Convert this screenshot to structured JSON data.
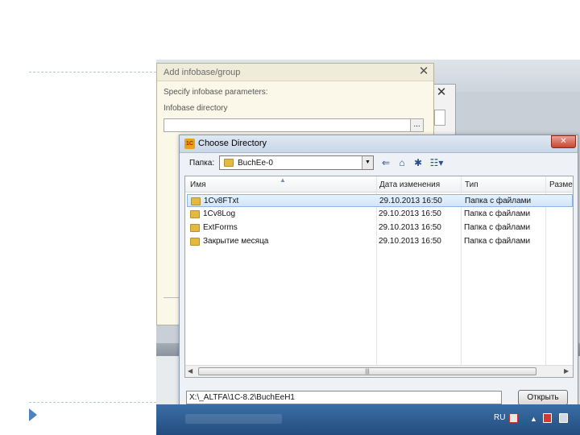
{
  "infobase_dialog": {
    "title": "Add infobase/group",
    "subtitle": "Specify infobase parameters:",
    "directory_label": "Infobase directory",
    "directory_value": "",
    "browse_label": "..."
  },
  "choose_dialog": {
    "title": "Choose Directory",
    "logo_text": "1C",
    "folder_label": "Папка:",
    "folder_value": "BuchEe-0",
    "columns": [
      "Имя",
      "Дата изменения",
      "Тип",
      "Разме"
    ],
    "rows": [
      {
        "name": "1Cv8FTxt",
        "date": "29.10.2013 16:50",
        "type": "Папка с файлами",
        "selected": true
      },
      {
        "name": "1Cv8Log",
        "date": "29.10.2013 16:50",
        "type": "Папка с файлами",
        "selected": false
      },
      {
        "name": "ExtForms",
        "date": "29.10.2013 16:50",
        "type": "Папка с файлами",
        "selected": false
      },
      {
        "name": "Закрытие месяца",
        "date": "29.10.2013 16:50",
        "type": "Папка с файлами",
        "selected": false
      }
    ],
    "path_value": "X:\\_ALTFA\\1C-8.2\\BuchEeH1",
    "open_button": "Открыть"
  },
  "taskbar": {
    "language": "RU"
  }
}
